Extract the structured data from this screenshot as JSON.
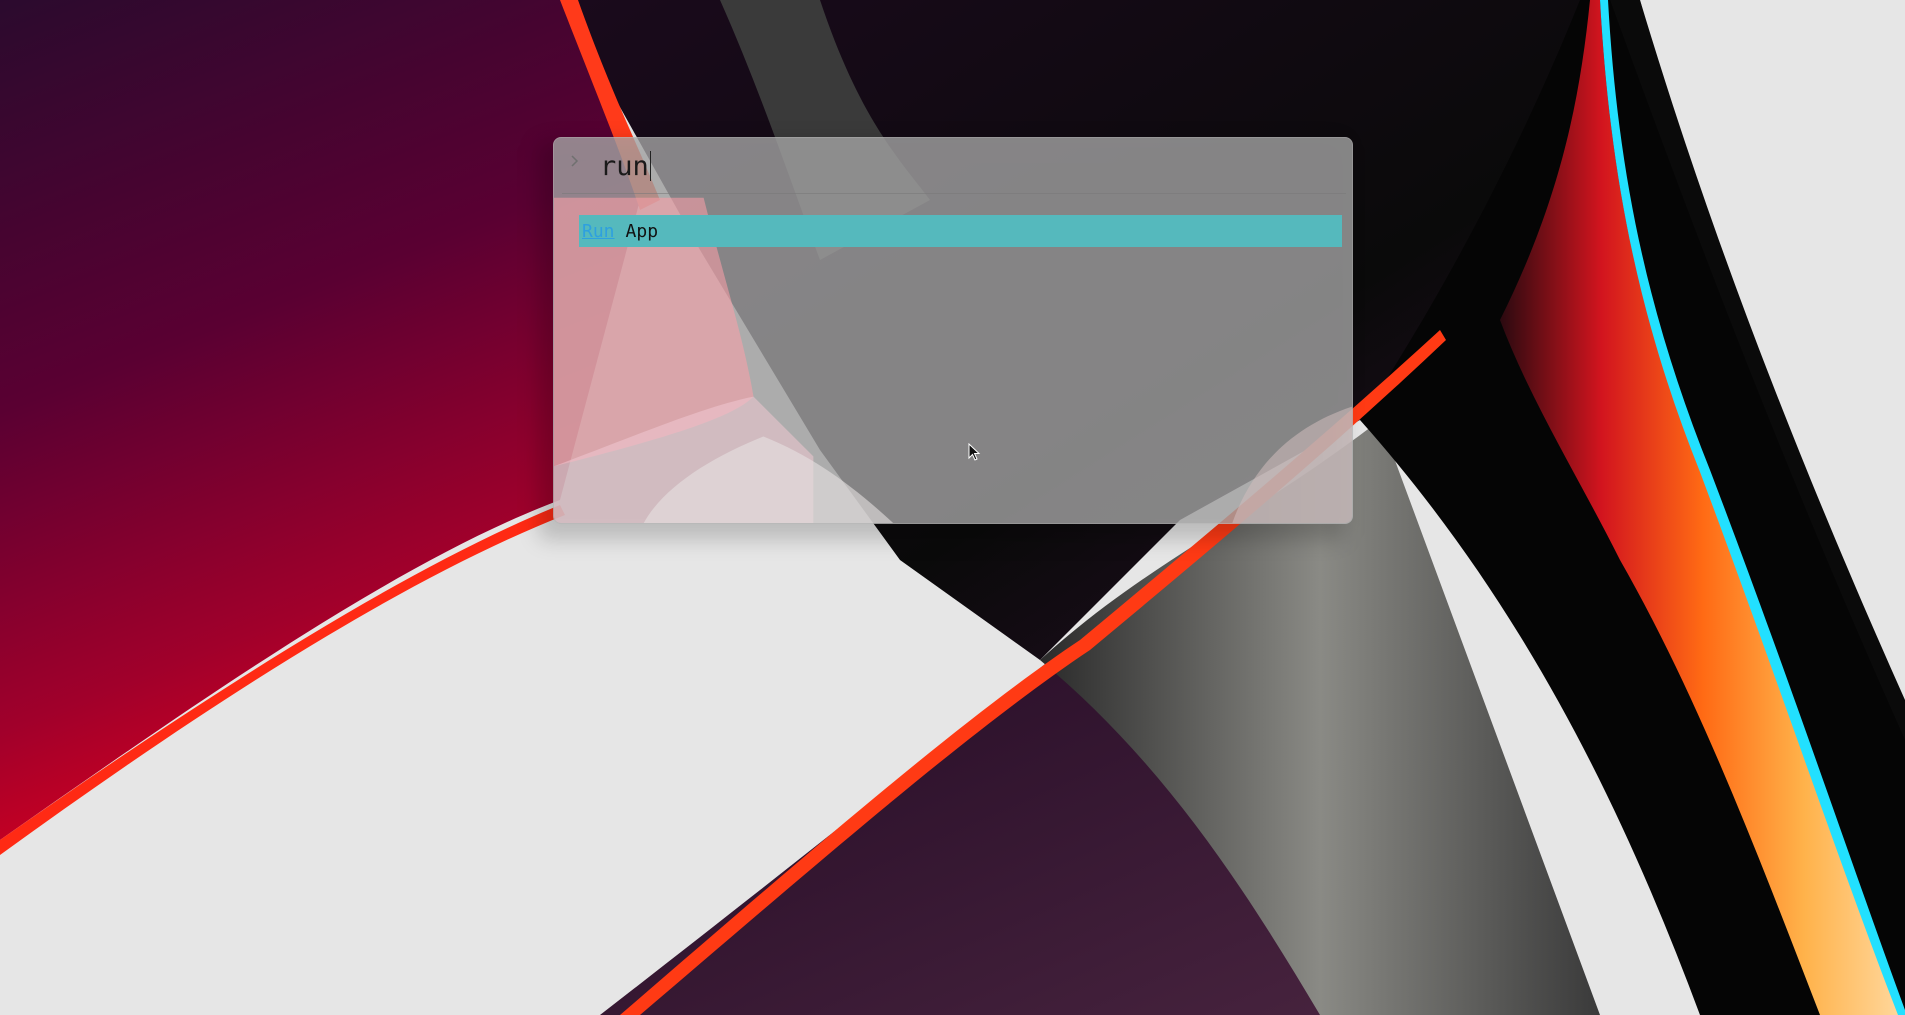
{
  "launcher": {
    "prompt_icon": "chevron-right-icon",
    "query": "run",
    "results": [
      {
        "match": "Run",
        "rest": "App",
        "selected": true
      }
    ]
  },
  "colors": {
    "highlight": "#55b9bd",
    "match_text": "#2ea0df",
    "panel": "#a8a8a8"
  },
  "cursor_icon": "mouse-pointer-icon"
}
